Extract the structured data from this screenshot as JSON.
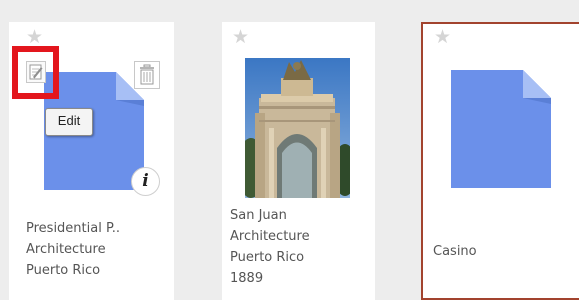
{
  "cards": [
    {
      "star_icon": "star-icon",
      "edit_icon": "edit-icon",
      "delete_icon": "trash-icon",
      "tooltip": "Edit",
      "info_icon": "info-icon",
      "info_glyph": "i",
      "caption_lines": [
        "Presidential P..",
        "Architecture",
        "Puerto Rico"
      ]
    },
    {
      "star_icon": "star-icon",
      "caption_lines": [
        "San Juan",
        "Architecture",
        "Puerto Rico",
        "1889"
      ]
    },
    {
      "star_icon": "star-icon",
      "caption_lines": [
        "Casino"
      ],
      "selected": true
    }
  ],
  "colors": {
    "doc_blue": "#6b90ea",
    "doc_fold": "#a7bff5",
    "highlight_red": "#e3161d",
    "selected_border": "#a2432e"
  }
}
